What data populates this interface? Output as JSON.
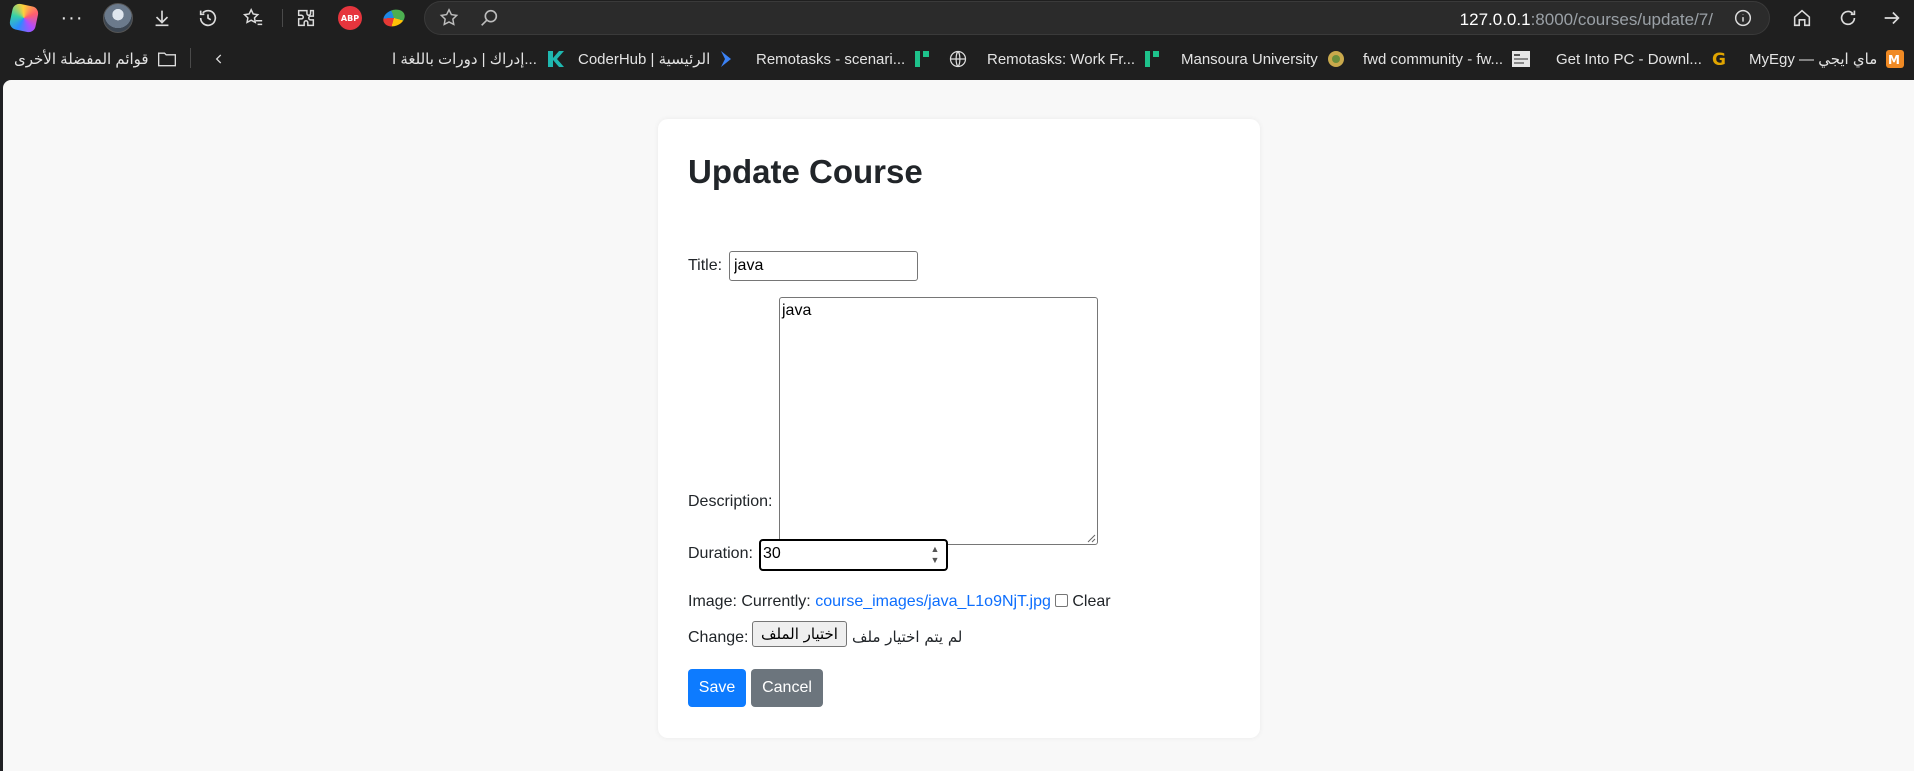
{
  "browser": {
    "url_host": "127.0.0.1",
    "url_rest": ":8000/courses/update/7/",
    "abp_label": "ABP"
  },
  "bookmarks": {
    "other_favorites": "قوائم المفضلة الأخرى",
    "items": [
      {
        "label": "إدراك | دورات باللغة ا...",
        "icon_color": "#1fb8b0"
      },
      {
        "label": "CoderHub | الرئيسية",
        "icon_color": "#3b82f6"
      },
      {
        "label": "Remotasks - scenari...",
        "icon_color": "#1ec28b"
      },
      {
        "label": "Remotasks: Work Fr...",
        "icon_color": "#1ec28b"
      },
      {
        "label": "Mansoura University",
        "icon_color": "#c9a94c"
      },
      {
        "label": "fwd community - fw...",
        "icon_color": "#d9d9d9"
      },
      {
        "label": "Get Into PC - Downl...",
        "icon_color": "#e0a400"
      },
      {
        "label": "MyEgy — ماي ايجي",
        "icon_color": "#f08a24"
      }
    ]
  },
  "form": {
    "heading": "Update Course",
    "title_label": "Title:",
    "title_value": "java",
    "description_label": "Description:",
    "description_value": "java",
    "duration_label": "Duration:",
    "duration_value": "30",
    "image_label": "Image:",
    "currently_label": "Currently:",
    "image_link": "course_images/java_L1o9NjT.jpg",
    "clear_label": "Clear",
    "change_label": "Change:",
    "file_button": "اختيار الملف",
    "no_file_text": "لم يتم اختيار ملف",
    "save_label": "Save",
    "cancel_label": "Cancel"
  },
  "colors": {
    "primary": "#0d7bff",
    "secondary": "#6c757d",
    "link": "#0d6efd"
  }
}
